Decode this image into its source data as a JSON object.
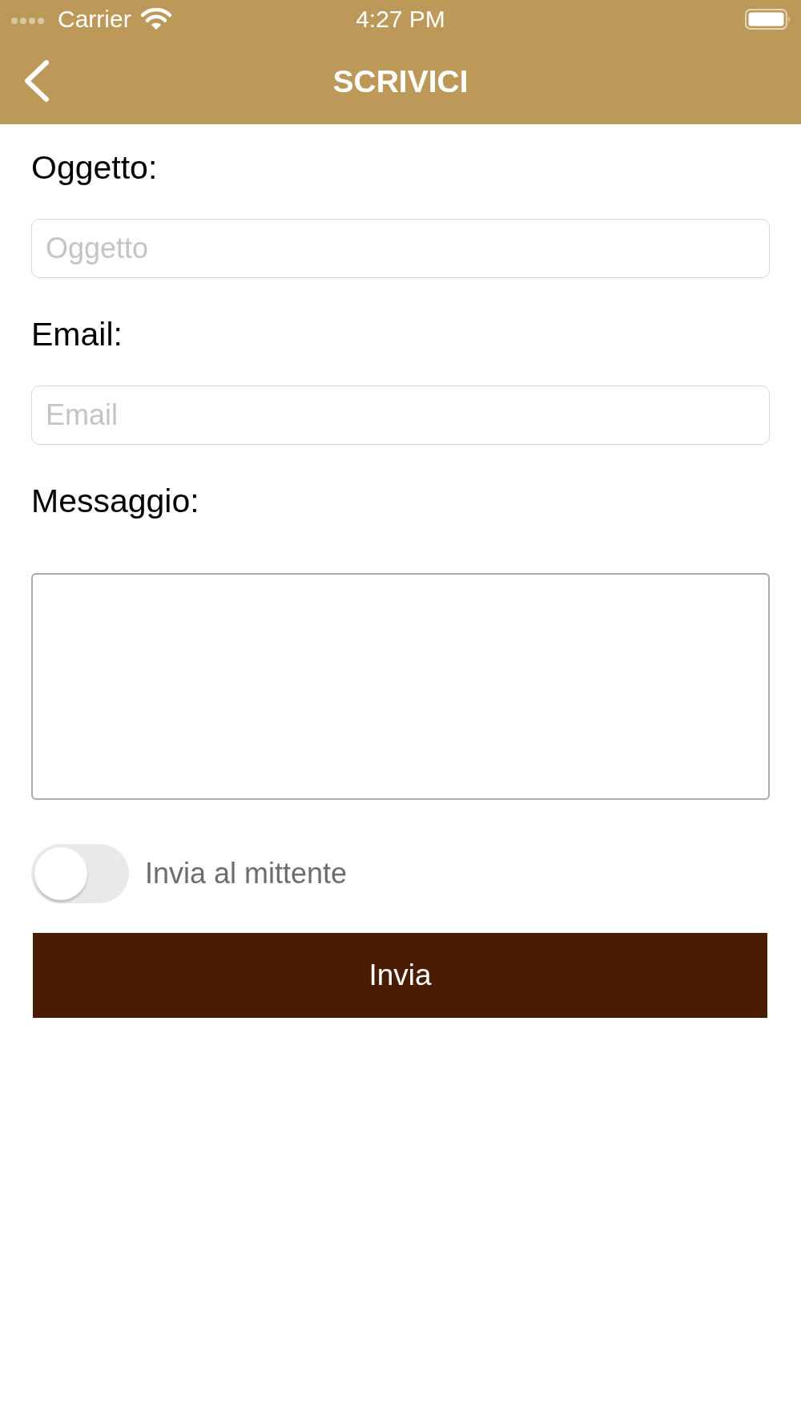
{
  "status_bar": {
    "carrier": "Carrier",
    "time": "4:27 PM"
  },
  "nav_bar": {
    "title": "SCRIVICI"
  },
  "form": {
    "fields": [
      {
        "kind": "input",
        "label": "Oggetto:",
        "placeholder": "Oggetto"
      },
      {
        "kind": "input",
        "label": "Email:",
        "placeholder": "Email"
      },
      {
        "kind": "textarea",
        "label": "Messaggio:"
      }
    ],
    "toggle": {
      "label": "Invia al mittente",
      "on": false
    },
    "submit_button": "Invia"
  }
}
